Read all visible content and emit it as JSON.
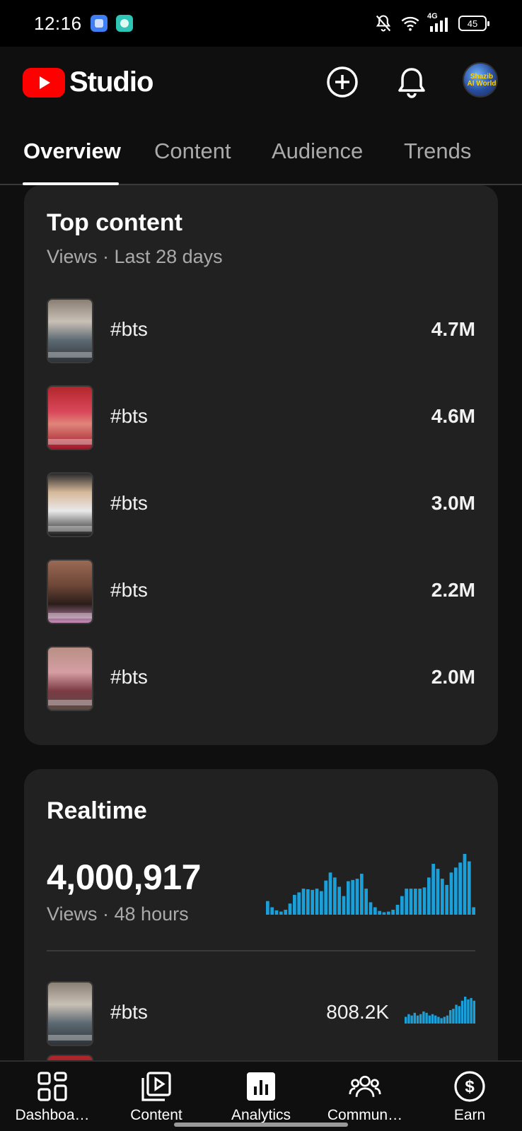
{
  "status_bar": {
    "time": "12:16",
    "network": "4G",
    "battery": "45"
  },
  "header": {
    "logo_text": "Studio",
    "avatar_text": "Shazib AI World"
  },
  "tabs": [
    {
      "label": "Overview",
      "active": true
    },
    {
      "label": "Content",
      "active": false
    },
    {
      "label": "Audience",
      "active": false
    },
    {
      "label": "Trends",
      "active": false
    }
  ],
  "top_content": {
    "title": "Top content",
    "subtitle": "Views · Last 28 days",
    "items": [
      {
        "title": "#bts",
        "views": "4.7M"
      },
      {
        "title": "#bts",
        "views": "4.6M"
      },
      {
        "title": "#bts",
        "views": "3.0M"
      },
      {
        "title": "#bts",
        "views": "2.2M"
      },
      {
        "title": "#bts",
        "views": "2.0M"
      }
    ]
  },
  "realtime": {
    "title": "Realtime",
    "views_total": "4,000,917",
    "subtitle": "Views · 48 hours",
    "chart_color": "#1a9fd8",
    "bars": [
      22,
      12,
      7,
      5,
      8,
      18,
      32,
      36,
      42,
      41,
      40,
      42,
      38,
      55,
      68,
      60,
      45,
      30,
      54,
      56,
      58,
      66,
      42,
      20,
      12,
      6,
      4,
      5,
      8,
      16,
      30,
      42,
      42,
      42,
      42,
      44,
      60,
      82,
      74,
      58,
      48,
      68,
      76,
      84,
      98,
      86,
      12
    ],
    "items": [
      {
        "title": "#bts",
        "views": "808.2K",
        "bars": [
          10,
          14,
          12,
          16,
          12,
          14,
          18,
          16,
          12,
          14,
          12,
          10,
          8,
          10,
          12,
          20,
          22,
          28,
          26,
          34,
          40,
          36,
          38,
          34
        ]
      }
    ]
  },
  "bottom_nav": [
    {
      "label": "Dashboa…",
      "icon": "dashboard-icon"
    },
    {
      "label": "Content",
      "icon": "content-icon"
    },
    {
      "label": "Analytics",
      "icon": "analytics-icon",
      "active": true
    },
    {
      "label": "Commun…",
      "icon": "community-icon"
    },
    {
      "label": "Earn",
      "icon": "earn-icon"
    }
  ]
}
